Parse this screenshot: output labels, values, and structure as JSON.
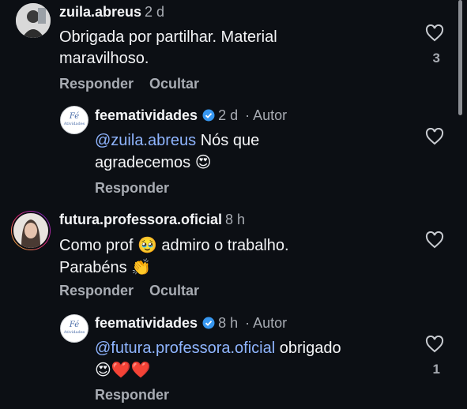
{
  "comments": [
    {
      "user": "zuila.abreus",
      "time": "2 d",
      "text_line1": "Obrigada por partilhar. Material",
      "text_line2": "maravilhoso.",
      "likes": "3",
      "reply_label": "Responder",
      "hide_label": "Ocultar"
    },
    {
      "user": "feematividades",
      "time": "2 d",
      "author_badge": "Autor",
      "mention": "@zuila.abreus",
      "text_line1_rest": " Nós que",
      "text_line2": "agradecemos",
      "emoji": "😍",
      "reply_label": "Responder"
    },
    {
      "user": "futura.professora.oficial",
      "time": "8 h",
      "text_line1_a": "Como prof",
      "emoji_a": "🥹",
      "text_line1_b": "admiro o trabalho.",
      "text_line2": "Parabéns",
      "emoji_b": "👏",
      "reply_label": "Responder",
      "hide_label": "Ocultar"
    },
    {
      "user": "feematividades",
      "time": "8 h",
      "author_badge": "Autor",
      "mention": "@futura.professora.oficial",
      "text_line1_rest": " obrigado",
      "emojis": "😍❤️❤️",
      "likes": "1",
      "reply_label": "Responder"
    }
  ],
  "avatar_logo_text": "Atividades",
  "colors": {
    "background": "#0c0f14",
    "text": "#f4f5f7",
    "secondary": "#a8acb3",
    "mention": "#8fb5ff",
    "verified": "#3797f0"
  }
}
